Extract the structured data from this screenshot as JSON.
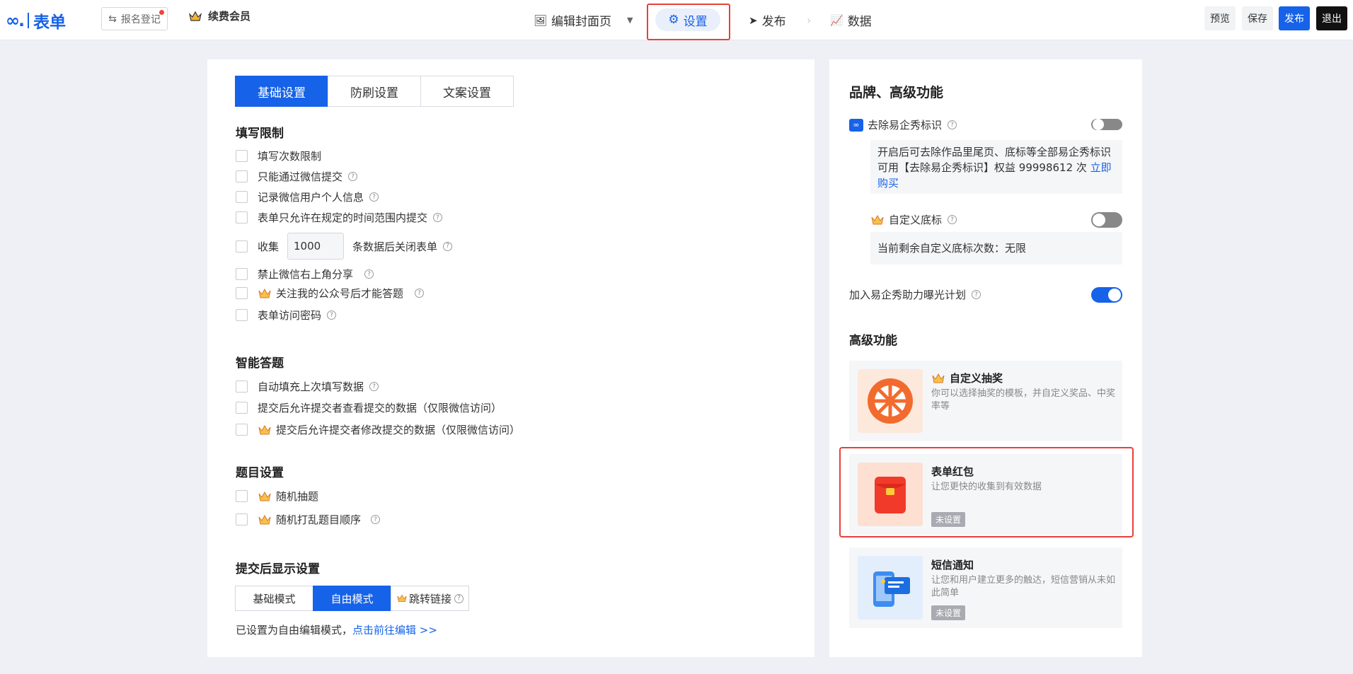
{
  "topbar": {
    "logo_text": "表单",
    "register_btn": "报名登记",
    "vip_label": "续费会员",
    "nav_cover": "编辑封面页",
    "nav_settings": "设置",
    "nav_publish": "发布",
    "nav_arrow": "›",
    "nav_data": "数据",
    "btn_preview": "预览",
    "btn_save": "保存",
    "btn_publish": "发布",
    "btn_exit": "退出"
  },
  "tabs": [
    "基础设置",
    "防刷设置",
    "文案设置"
  ],
  "fill_limit": {
    "title": "填写限制",
    "items": [
      "填写次数限制",
      "只能通过微信提交",
      "记录微信用户个人信息",
      "表单只允许在规定的时间范围内提交"
    ],
    "collect_prefix": "收集",
    "collect_value": "1000",
    "collect_suffix": "条数据后关闭表单",
    "ban_share": "禁止微信右上角分享",
    "follow_official": "关注我的公众号后才能答题",
    "access_password": "表单访问密码"
  },
  "smart_answer": {
    "title": "智能答题",
    "items": [
      "自动填充上次填写数据",
      "提交后允许提交者查看提交的数据（仅限微信访问）",
      "提交后允许提交者修改提交的数据（仅限微信访问）"
    ]
  },
  "question_settings": {
    "title": "题目设置",
    "items": [
      "随机抽题",
      "随机打乱题目顺序"
    ]
  },
  "after_submit": {
    "title": "提交后显示设置",
    "modes": [
      "基础模式",
      "自由模式",
      "跳转链接"
    ],
    "note_prefix": "已设置为自由编辑模式，",
    "note_link": "点击前往编辑 >>"
  },
  "brand": {
    "title": "品牌、高级功能",
    "remove_logo_label": "去除易企秀标识",
    "remove_logo_info": "开启后可去除作品里尾页、底标等全部易企秀标识 可用【去除易企秀标识】权益 99998612 次 ",
    "remove_logo_link": "立即购买",
    "custom_footer_label": "自定义底标",
    "custom_footer_info": "当前剩余自定义底标次数：无限",
    "exposure_label": "加入易企秀助力曝光计划"
  },
  "advanced": {
    "title": "高级功能",
    "lottery_title": "自定义抽奖",
    "lottery_desc": "你可以选择抽奖的模板，并自定义奖品、中奖率等",
    "redpacket_title": "表单红包",
    "redpacket_desc": "让您更快的收集到有效数据",
    "redpacket_badge": "未设置",
    "sms_title": "短信通知",
    "sms_desc": "让您和用户建立更多的触达，短信营销从未如此简单",
    "sms_badge": "未设置"
  }
}
